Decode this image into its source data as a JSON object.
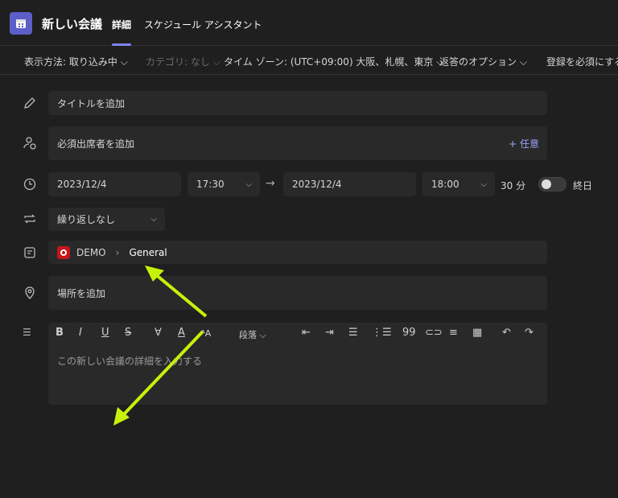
{
  "header": {
    "title": "新しい会議",
    "tabs": [
      "詳細",
      "スケジュール アシスタント"
    ]
  },
  "toolbar": {
    "show_as": "表示方法: 取り込み中",
    "category": "カテゴリ: なし",
    "timezone": "タイム ゾーン: (UTC+09:00) 大阪、札幌、東京",
    "response_options": "返答のオプション",
    "require_registration": "登録を必須にする"
  },
  "form": {
    "title_placeholder": "タイトルを追加",
    "attendees_placeholder": "必須出席者を追加",
    "optional_label": "+ 任意",
    "start_date": "2023/12/4",
    "start_time": "17:30",
    "end_date": "2023/12/4",
    "end_time": "18:00",
    "duration": "30 分",
    "all_day_label": "終日",
    "all_day": false,
    "repeat": "繰り返しなし",
    "team": "DEMO",
    "channel": "General",
    "location_placeholder": "場所を追加",
    "paragraph_label": "段落",
    "details_placeholder": "この新しい会議の詳細を入力する"
  },
  "colors": {
    "accent": "#5b5fc7",
    "annotation_arrow": "#c6f20a"
  }
}
